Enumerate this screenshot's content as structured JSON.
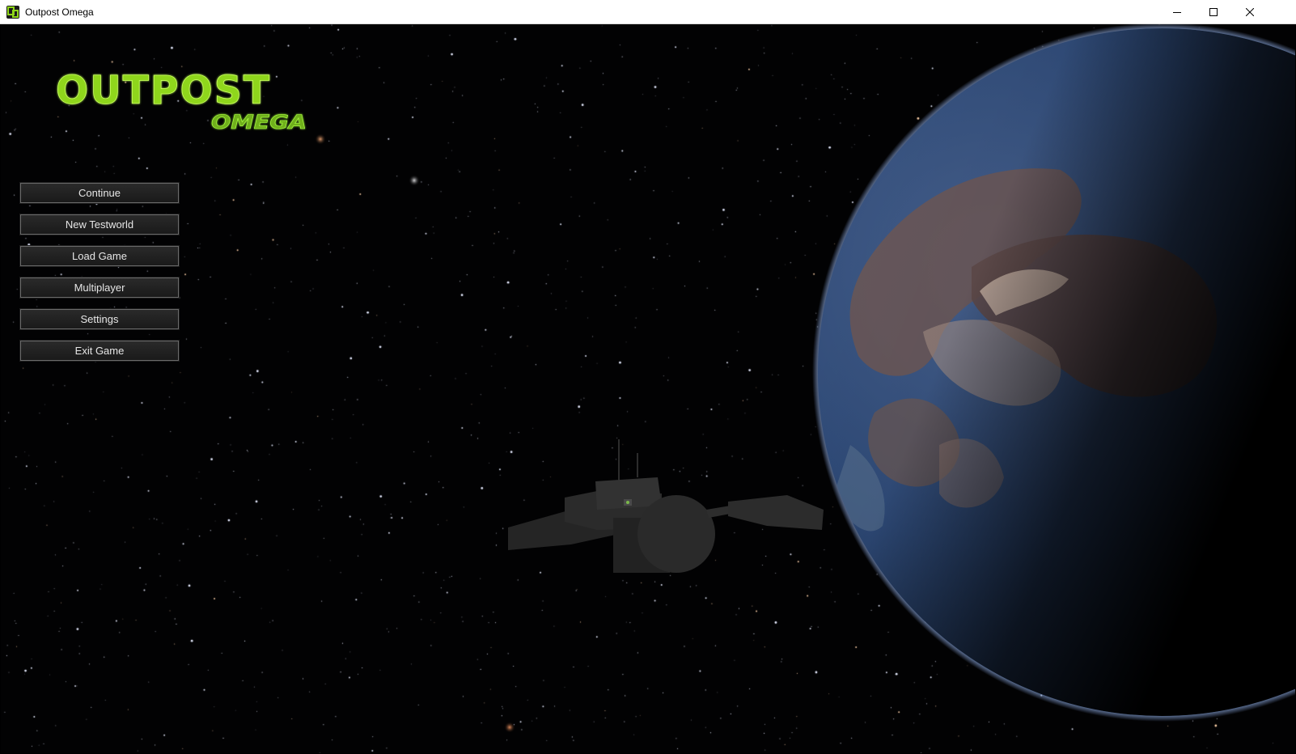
{
  "window": {
    "title": "Outpost Omega",
    "controls": [
      "minimize-icon",
      "maximize-icon",
      "close-icon"
    ]
  },
  "logo": {
    "line1": "OUTPOST",
    "line2": "OMEGA",
    "color": "#8fd61a"
  },
  "menu": {
    "items": [
      {
        "id": "continue",
        "label": "Continue"
      },
      {
        "id": "new-testworld",
        "label": "New Testworld"
      },
      {
        "id": "load-game",
        "label": "Load Game"
      },
      {
        "id": "multiplayer",
        "label": "Multiplayer"
      },
      {
        "id": "settings",
        "label": "Settings"
      },
      {
        "id": "exit-game",
        "label": "Exit Game"
      }
    ]
  },
  "scene": {
    "background": "#020203",
    "planet_ocean": "#2e4a78",
    "planet_land": "#6a5552",
    "ship_color": "#2a2a2a"
  }
}
